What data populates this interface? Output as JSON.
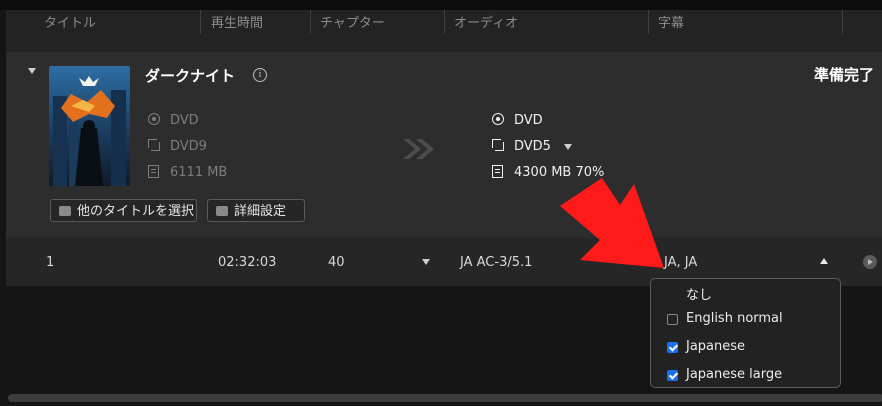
{
  "header": {
    "col_title": "タイトル",
    "col_duration": "再生時間",
    "col_chapter": "チャプター",
    "col_audio": "オーディオ",
    "col_subtitle": "字幕"
  },
  "disc": {
    "title": "ダークナイト",
    "status": "準備完了",
    "source": {
      "type": "DVD",
      "layer": "DVD9",
      "size": "6111 MB"
    },
    "target": {
      "type": "DVD",
      "layer": "DVD5",
      "size": "4300 MB 70%"
    }
  },
  "buttons": {
    "select_titles": "他のタイトルを選択",
    "advanced_settings": "詳細設定"
  },
  "title_row": {
    "index": "1",
    "duration": "02:32:03",
    "chapters": "40",
    "audio": "JA  AC-3/5.1",
    "subtitles": "JA, JA"
  },
  "subtitle_options": [
    {
      "label": "なし",
      "checked": false,
      "checkbox": false
    },
    {
      "label": "English normal",
      "checked": false,
      "checkbox": true
    },
    {
      "label": "Japanese",
      "checked": true,
      "checkbox": true
    },
    {
      "label": "Japanese large",
      "checked": true,
      "checkbox": true
    }
  ],
  "colors": {
    "accent": "#1d6ff2",
    "annotation_arrow": "#ff1a1a",
    "background": "#151515",
    "panel": "#2d2d2d"
  },
  "icons": {
    "disc": "disc-icon",
    "layer": "layer-icon",
    "size": "file-size-icon",
    "convert": "double-chevron-right-icon",
    "info": "info-icon"
  }
}
